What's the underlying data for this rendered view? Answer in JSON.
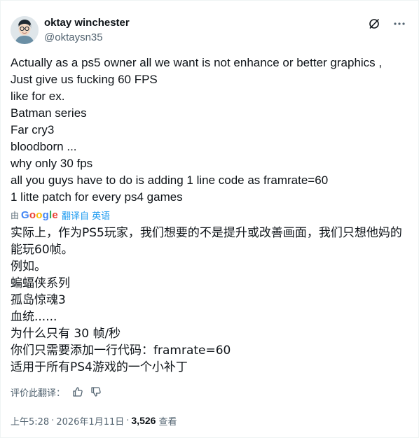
{
  "author": {
    "display_name": "oktay winchester",
    "handle": "@oktaysn35"
  },
  "icons": {
    "grok": "grok-slash-icon",
    "more": "more-dots-icon",
    "thumbs_up": "thumbs-up-icon",
    "thumbs_down": "thumbs-down-icon"
  },
  "tweet": {
    "lines": [
      "Actually as a ps5 owner all we want is not enhance or better graphics ,",
      "Just give us fucking 60 FPS",
      "like for ex.",
      "Batman series",
      "Far cry3",
      "bloodborn ...",
      "why only 30 fps",
      "all you guys have to do is adding 1 line code as framrate=60",
      "1 litte patch for every ps4 games"
    ]
  },
  "translation": {
    "by": "由",
    "google": "Google",
    "from": "翻译自 英语",
    "lines": [
      "实际上，作为PS5玩家，我们想要的不是提升或改善画面，我们只想他妈的",
      "能玩60帧。",
      "例如。",
      "蝙蝠侠系列",
      "孤岛惊魂3",
      "血统......",
      "为什么只有 30 帧/秒",
      "你们只需要添加一行代码：framrate=60",
      "适用于所有PS4游戏的一个小补丁"
    ],
    "rate_label": "评价此翻译："
  },
  "meta": {
    "time": "上午5:28",
    "separator": "·",
    "date": "2026年1月11日",
    "views_count": "3,526",
    "views_label": "查看"
  },
  "colors": {
    "text": "#0f1419",
    "secondary": "#536471",
    "link": "#1d9bf0"
  }
}
